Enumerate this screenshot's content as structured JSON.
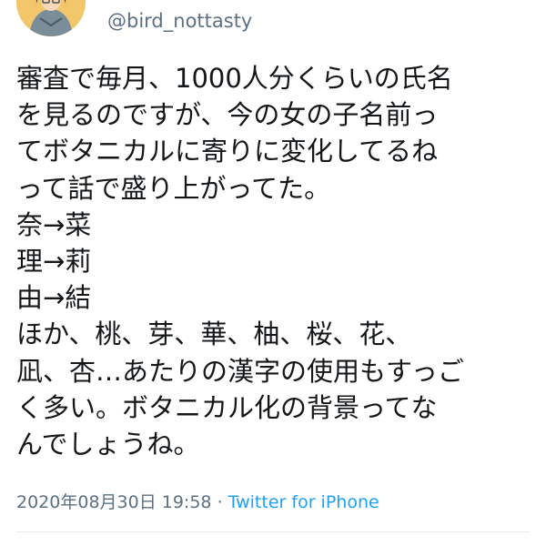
{
  "header": {
    "handle": "@bird_nottasty",
    "avatar_icon": "user-avatar-icon"
  },
  "tweet": {
    "lines": [
      "審査で毎月、1000人分くらいの氏名",
      "を見るのですが、今の女の子名前っ",
      "てボタニカルに寄りに変化してるね",
      "って話で盛り上がってた。",
      "奈→菜",
      "理→莉",
      "由→結",
      "ほか、桃、芽、華、柚、桜、花、",
      "凪、杏…あたりの漢字の使用もすっご",
      "く多い。ボタニカル化の背景ってな",
      "んでしょうね。"
    ]
  },
  "meta": {
    "timestamp": "2020年08月30日 19:58",
    "separator": "·",
    "source": "Twitter for iPhone"
  },
  "colors": {
    "text": "#14171a",
    "muted": "#5b7083",
    "link": "#1da1f2",
    "divider": "#e6ecf0"
  }
}
